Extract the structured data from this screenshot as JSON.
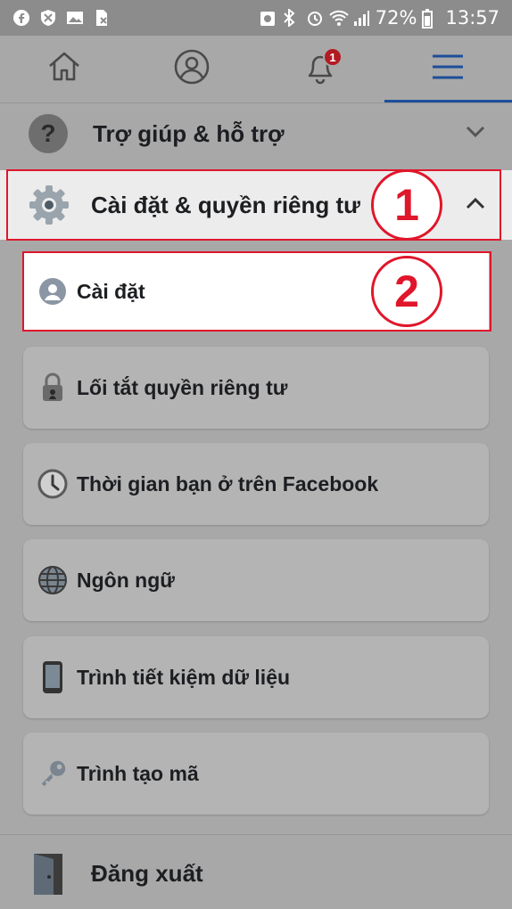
{
  "status_bar": {
    "battery": "72%",
    "time": "13:57",
    "left_icons": [
      "facebook-icon",
      "shield-icon",
      "image-icon",
      "sim-off-icon"
    ],
    "right_icons": [
      "recycle-icon",
      "bluetooth-icon",
      "alarm-icon",
      "wifi-icon",
      "signal-icon",
      "battery-icon"
    ]
  },
  "nav": {
    "tabs": [
      "home-icon",
      "profile-icon",
      "bell-icon",
      "menu-icon"
    ],
    "notification_count": "1",
    "active_tab": "menu"
  },
  "sections": {
    "help": {
      "label": "Trợ giúp & hỗ trợ",
      "icon": "question-icon"
    },
    "settings_privacy": {
      "label": "Cài đặt & quyền riêng tư",
      "icon": "gear-icon"
    },
    "logout": {
      "label": "Đăng xuất",
      "icon": "door-icon"
    }
  },
  "submenu": [
    {
      "label": "Cài đặt",
      "icon": "user-circle-icon"
    },
    {
      "label": "Lối tắt quyền riêng tư",
      "icon": "lock-icon"
    },
    {
      "label": "Thời gian bạn ở trên Facebook",
      "icon": "clock-icon"
    },
    {
      "label": "Ngôn ngữ",
      "icon": "globe-icon"
    },
    {
      "label": "Trình tiết kiệm dữ liệu",
      "icon": "phone-icon"
    },
    {
      "label": "Trình tạo mã",
      "icon": "key-icon"
    }
  ],
  "annotations": {
    "step1": "1",
    "step2": "2"
  },
  "colors": {
    "highlight": "#e0162b",
    "nav_accent": "#1d4e9a",
    "badge": "#b31b22"
  }
}
